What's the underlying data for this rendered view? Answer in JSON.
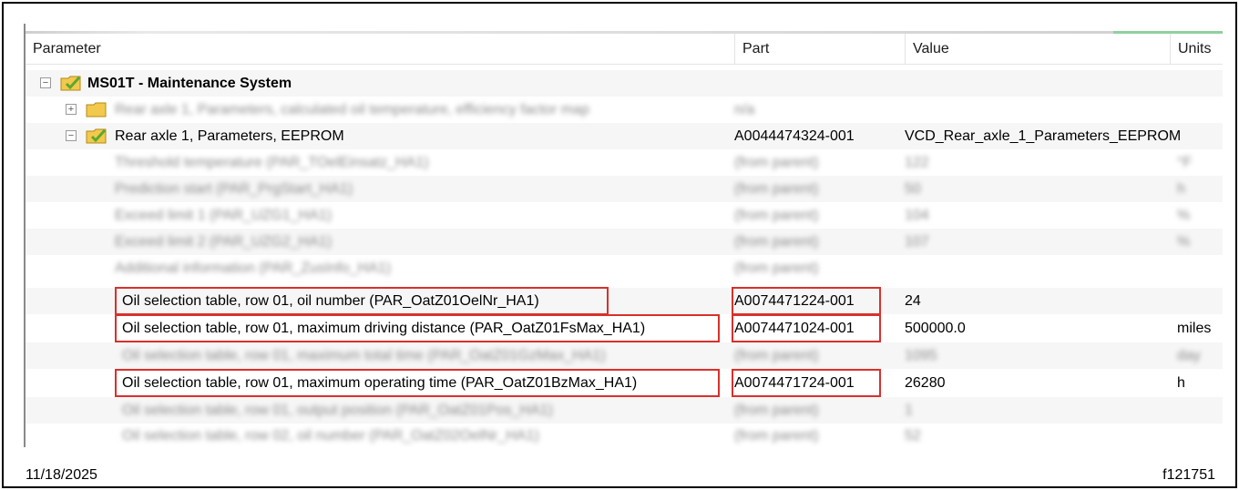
{
  "columns": {
    "parameter": "Parameter",
    "part": "Part",
    "value": "Value",
    "units": "Units"
  },
  "root": {
    "label": "MS01T - Maintenance System"
  },
  "rows": [
    {
      "label": "Rear axle 1, Parameters, calculated oil temperature, efficiency factor map",
      "part": "n/a",
      "value": "",
      "units": "",
      "blurred": true
    },
    {
      "label": "Rear axle 1, Parameters, EEPROM",
      "part": "A0044474324-001",
      "value": "VCD_Rear_axle_1_Parameters_EEPROM",
      "units": "",
      "blurred": false
    },
    {
      "label": "Threshold temperature (PAR_TOelEinsatz_HA1)",
      "part": "(from parent)",
      "value": "122",
      "units": "°F",
      "blurred": true
    },
    {
      "label": "Prediction start (PAR_PrgStart_HA1)",
      "part": "(from parent)",
      "value": "50",
      "units": "h",
      "blurred": true
    },
    {
      "label": "Exceed limit 1 (PAR_UZG1_HA1)",
      "part": "(from parent)",
      "value": "104",
      "units": "%",
      "blurred": true
    },
    {
      "label": "Exceed limit 2 (PAR_UZG2_HA1)",
      "part": "(from parent)",
      "value": "107",
      "units": "%",
      "blurred": true
    },
    {
      "label": "Additional information (PAR_ZusInfo_HA1)",
      "part": "(from parent)",
      "value": "",
      "units": "",
      "blurred": true
    },
    {
      "label": "Oil selection table, row 01, oil number (PAR_OatZ01OelNr_HA1)",
      "part": "A0074471224-001",
      "value": "24",
      "units": "",
      "blurred": false
    },
    {
      "label": "Oil selection table, row 01, maximum driving distance (PAR_OatZ01FsMax_HA1)",
      "part": "A0074471024-001",
      "value": "500000.0",
      "units": "miles",
      "blurred": false
    },
    {
      "label": "Oil selection table, row 01, maximum total time (PAR_OatZ01GzMax_HA1)",
      "part": "(from parent)",
      "value": "1095",
      "units": "day",
      "blurred": true
    },
    {
      "label": "Oil selection table, row 01, maximum operating time (PAR_OatZ01BzMax_HA1)",
      "part": "A0074471724-001",
      "value": "26280",
      "units": "h",
      "blurred": false
    },
    {
      "label": "Oil selection table, row 01, output position (PAR_OatZ01Pos_HA1)",
      "part": "(from parent)",
      "value": "1",
      "units": "",
      "blurred": true
    },
    {
      "label": "Oil selection table, row 02, oil number (PAR_OatZ02OelNr_HA1)",
      "part": "(from parent)",
      "value": "52",
      "units": "",
      "blurred": true
    }
  ],
  "footer": {
    "date": "11/18/2025",
    "figure_id": "f121751"
  },
  "colors": {
    "highlight": "#d9302c",
    "folder": "#f2c94c",
    "check": "#5aa832"
  }
}
